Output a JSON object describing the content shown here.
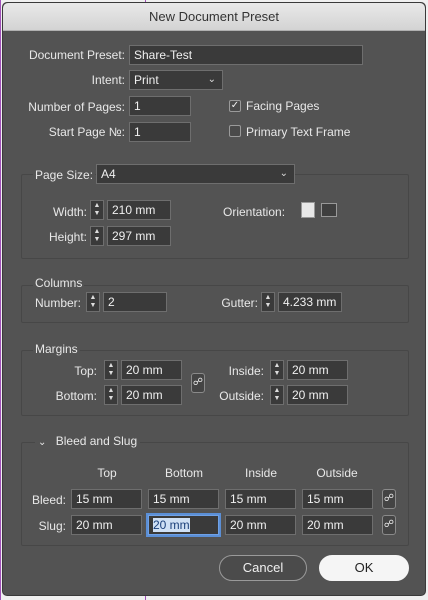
{
  "window": {
    "title": "New Document Preset"
  },
  "preset": {
    "label": "Document Preset:",
    "value": "Share-Test"
  },
  "intent": {
    "label": "Intent:",
    "value": "Print"
  },
  "pages": {
    "num_label": "Number of Pages:",
    "num_value": "1",
    "start_label": "Start Page №:",
    "start_value": "1",
    "facing_label": "Facing Pages",
    "facing_checked": true,
    "ptf_label": "Primary Text Frame",
    "ptf_checked": false
  },
  "page_size": {
    "label": "Page Size:",
    "value": "A4",
    "width_label": "Width:",
    "width_value": "210 mm",
    "height_label": "Height:",
    "height_value": "297 mm",
    "orientation_label": "Orientation:"
  },
  "columns": {
    "title": "Columns",
    "number_label": "Number:",
    "number_value": "2",
    "gutter_label": "Gutter:",
    "gutter_value": "4.233 mm"
  },
  "margins": {
    "title": "Margins",
    "top_label": "Top:",
    "top_value": "20 mm",
    "bottom_label": "Bottom:",
    "bottom_value": "20 mm",
    "inside_label": "Inside:",
    "inside_value": "20 mm",
    "outside_label": "Outside:",
    "outside_value": "20 mm"
  },
  "bleed_slug": {
    "title": "Bleed and Slug",
    "col_top": "Top",
    "col_bottom": "Bottom",
    "col_inside": "Inside",
    "col_outside": "Outside",
    "bleed_label": "Bleed:",
    "bleed": [
      "15 mm",
      "15 mm",
      "15 mm",
      "15 mm"
    ],
    "slug_label": "Slug:",
    "slug": [
      "20 mm",
      "20 mm",
      "20 mm",
      "20 mm"
    ]
  },
  "buttons": {
    "cancel": "Cancel",
    "ok": "OK"
  }
}
